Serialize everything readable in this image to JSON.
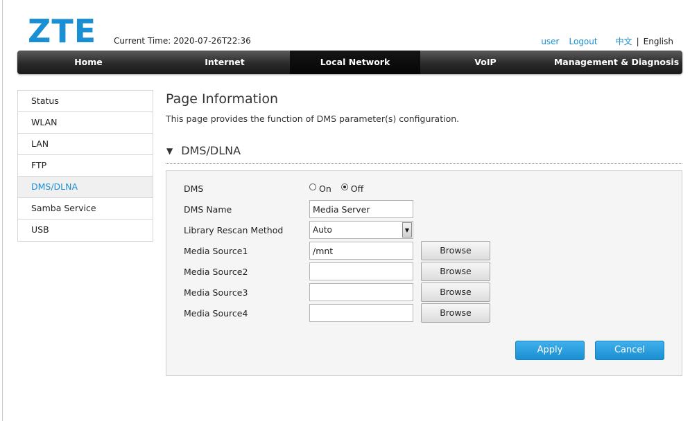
{
  "header": {
    "logo_text": "ZTE",
    "current_time": "Current Time: 2020-07-26T22:36",
    "user_link": "user",
    "logout_link": "Logout",
    "lang_cn": "中文",
    "lang_sep": "|",
    "lang_en": "English"
  },
  "nav": {
    "home": "Home",
    "internet": "Internet",
    "local_network": "Local Network",
    "voip": "VoIP",
    "management": "Management & Diagnosis",
    "active": "Local Network"
  },
  "sidebar": {
    "items": [
      {
        "label": "Status"
      },
      {
        "label": "WLAN"
      },
      {
        "label": "LAN"
      },
      {
        "label": "FTP"
      },
      {
        "label": "DMS/DLNA"
      },
      {
        "label": "Samba Service"
      },
      {
        "label": "USB"
      }
    ],
    "active": "DMS/DLNA"
  },
  "page": {
    "title": "Page Information",
    "description": "This page provides the function of DMS parameter(s) configuration.",
    "section_title": "DMS/DLNA"
  },
  "form": {
    "dms_label": "DMS",
    "dms_on": "On",
    "dms_off": "Off",
    "dms_selected": "Off",
    "dms_name_label": "DMS Name",
    "dms_name_value": "Media Server",
    "rescan_label": "Library Rescan Method",
    "rescan_value": "Auto",
    "sources": [
      {
        "label": "Media Source1",
        "value": "/mnt"
      },
      {
        "label": "Media Source2",
        "value": ""
      },
      {
        "label": "Media Source3",
        "value": ""
      },
      {
        "label": "Media Source4",
        "value": ""
      }
    ],
    "browse_label": "Browse",
    "apply_label": "Apply",
    "cancel_label": "Cancel"
  },
  "colors": {
    "accent": "#1a8fd3",
    "nav_bg": "#2a2a2a",
    "button_blue": "#2a9fe0"
  }
}
